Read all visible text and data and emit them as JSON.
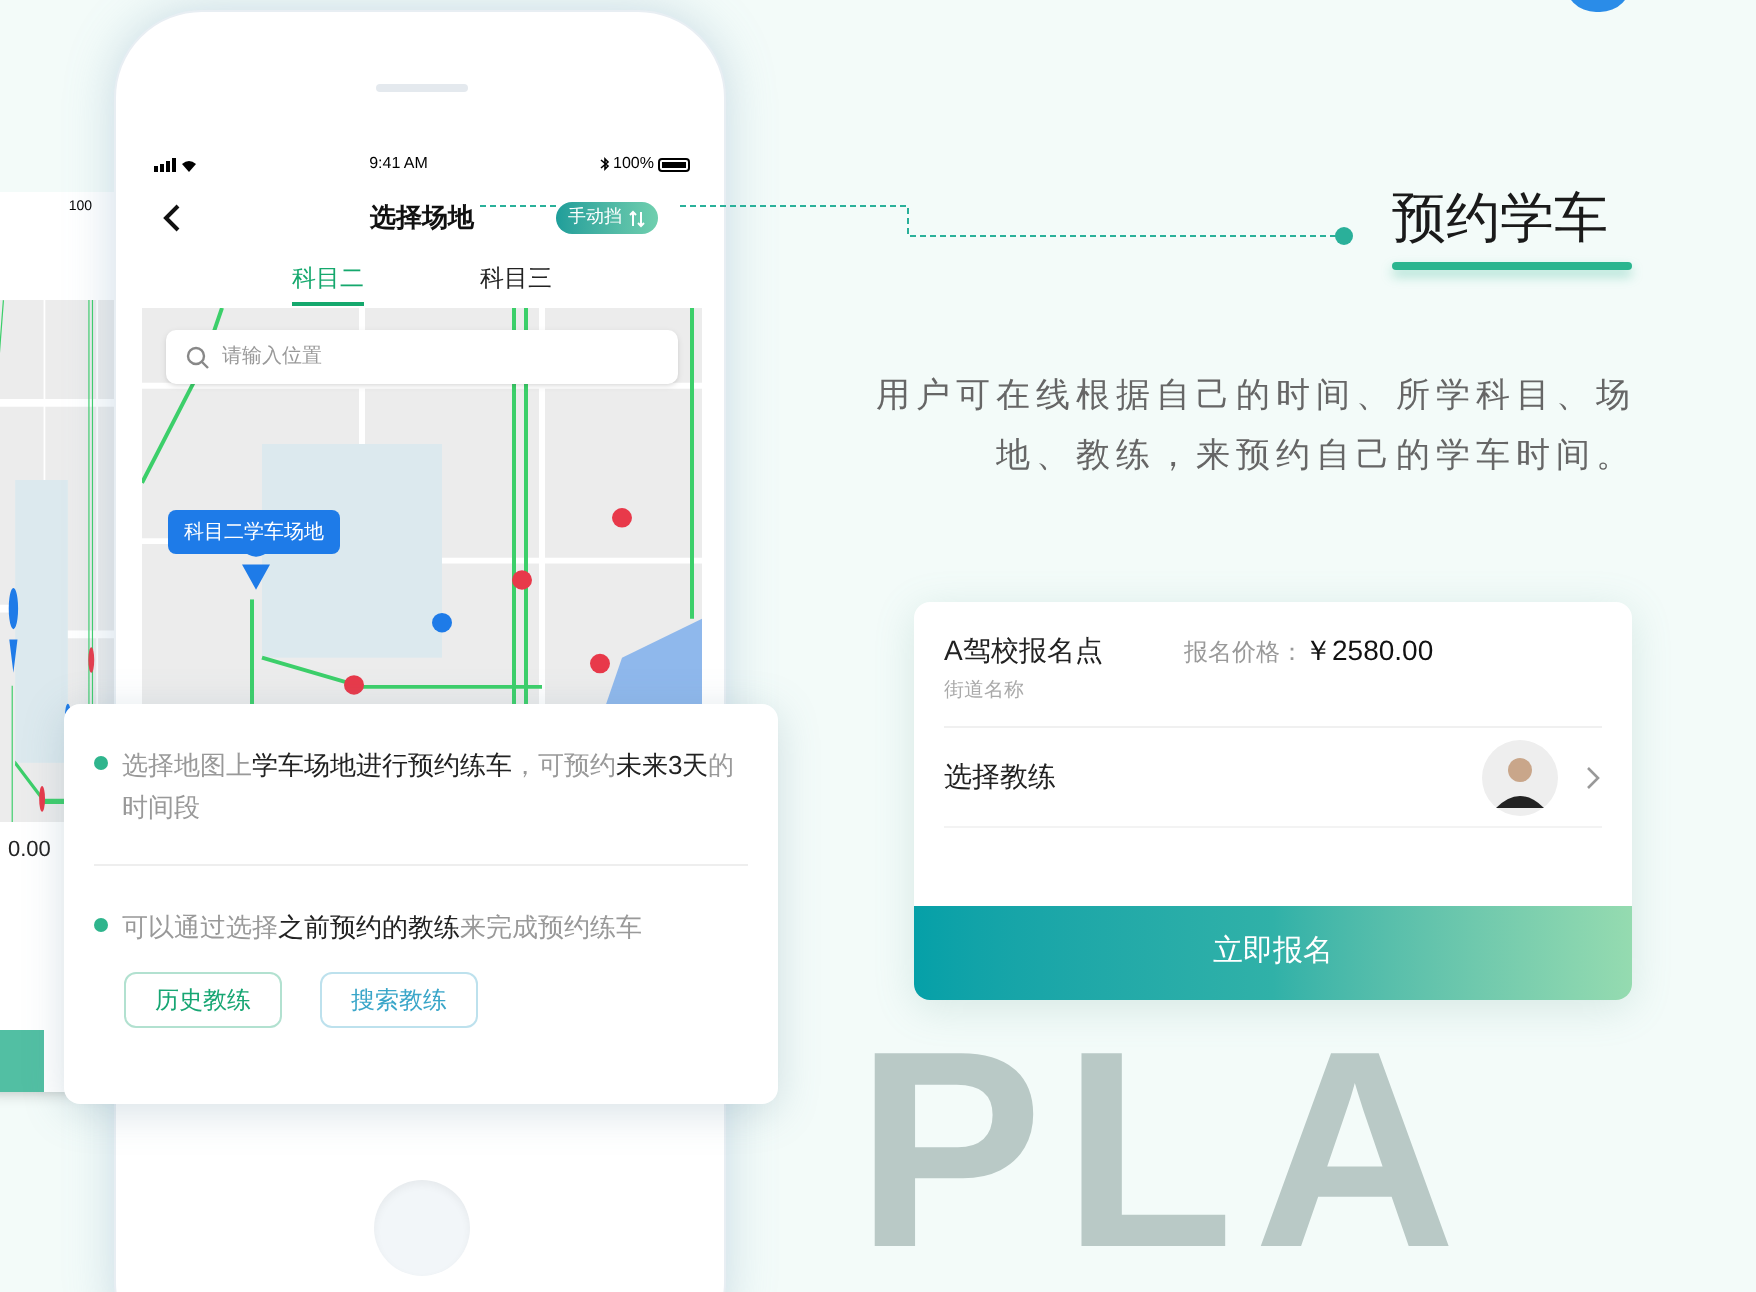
{
  "showcase": {
    "title": "预约学车",
    "description": "用户可在线根据自己的时间、所学科目、场地、教练，来预约自己的学车时间。",
    "backdrop_text": "PLA"
  },
  "back_phone": {
    "battery": "100",
    "price": "0.00"
  },
  "phone": {
    "time": "9:41 AM",
    "battery": "100%",
    "title": "选择场地",
    "badge": "手动挡",
    "tabs": [
      {
        "label": "科目二",
        "selected": true
      },
      {
        "label": "科目三",
        "selected": false
      }
    ],
    "search": {
      "placeholder": "请输入位置"
    },
    "map_callout": "科目二学车场地"
  },
  "tips": {
    "items": [
      "选择地图上**学车场地进行预约练车**，可预约**未来3天**的时间段",
      "可以通过选择**之前预约的教练**来完成预约练车"
    ],
    "buttons": [
      {
        "label": "历史教练",
        "color": "#17a673"
      },
      {
        "label": "搜索教练",
        "color": "#3aa6c9"
      }
    ]
  },
  "signup": {
    "school": "A驾校报名点",
    "street": "街道名称",
    "price_label": "报名价格：",
    "price": "￥2580.00",
    "coach_label": "选择教练",
    "submit": "立即报名"
  }
}
